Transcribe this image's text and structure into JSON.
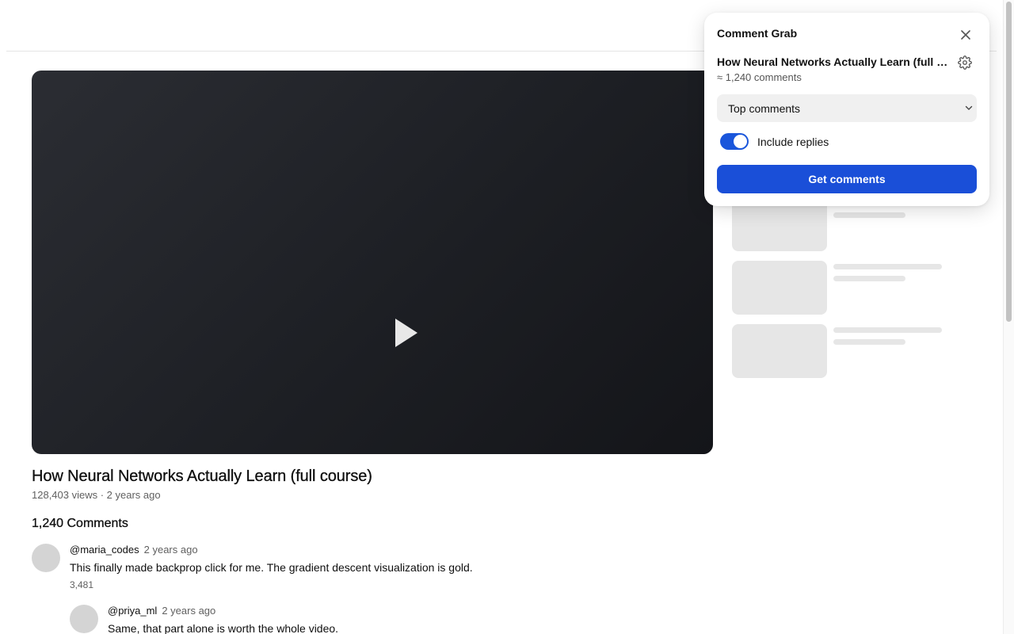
{
  "video": {
    "title": "How Neural Networks Actually Learn (full course)",
    "meta": "128,403 views · 2 years ago",
    "comments_heading": "1,240 Comments"
  },
  "comments": [
    {
      "author": "@maria_codes",
      "time": "2 years ago",
      "text": "This finally made backprop click for me. The gradient descent visualization is gold.",
      "likes": "3,481"
    },
    {
      "author": "@priya_ml",
      "time": "2 years ago",
      "text": "Same, that part alone is worth the whole video."
    }
  ],
  "popup": {
    "title": "Comment Grab",
    "video_name": "How Neural Networks Actually Learn (full course)",
    "comment_count": "≈ 1,240 comments",
    "sort": {
      "selected": "Top comments"
    },
    "include_replies": {
      "label": "Include replies",
      "checked": true
    },
    "button_label": "Get comments"
  },
  "icons": {
    "play": "play-icon",
    "close": "close-icon",
    "settings": "gear-icon",
    "dropdown": "chevron-down-icon"
  },
  "colors": {
    "accent": "#1a4fd8",
    "player_bg": "#1d1f24",
    "placeholder": "#e6e6e6"
  }
}
